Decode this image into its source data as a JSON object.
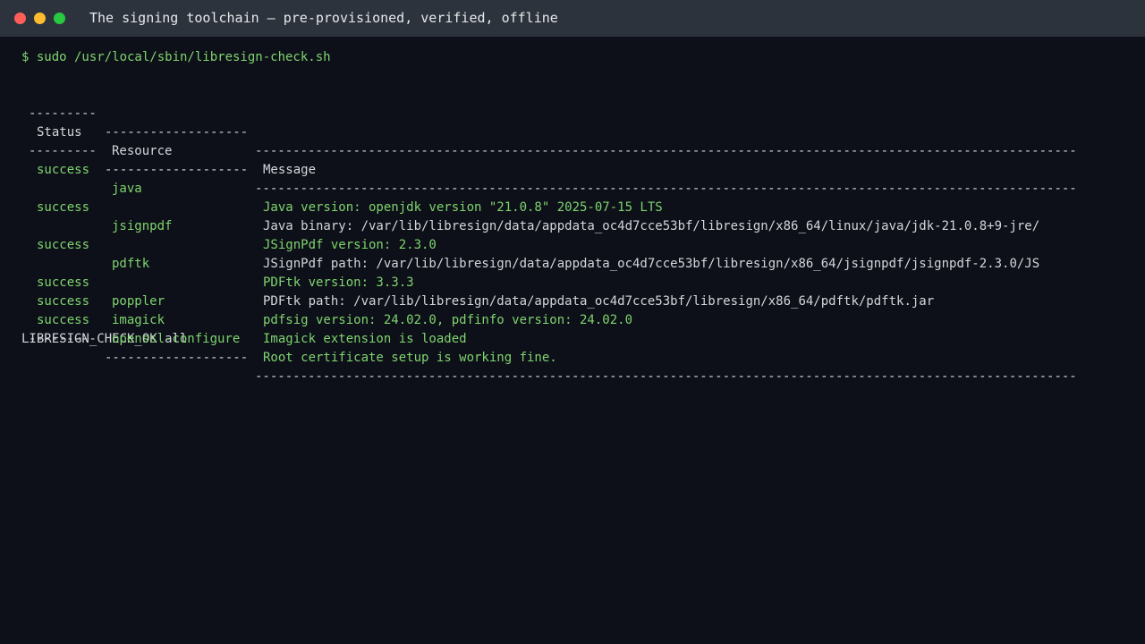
{
  "window": {
    "title": "The signing toolchain — pre-provisioned, verified, offline"
  },
  "terminal": {
    "command": "$ sudo /usr/local/sbin/libresign-check.sh",
    "separator": {
      "status": "---------",
      "resource": "-------------------",
      "message": "-------------------------------------------------------------------------------------------------------------"
    },
    "headers": {
      "status": "Status",
      "resource": "Resource",
      "message": "Message"
    },
    "rows": [
      {
        "status": "success",
        "resource": "java",
        "message": "Java version: openjdk version \"21.0.8\" 2025-07-15 LTS",
        "msg_color": "green"
      },
      {
        "status": "",
        "resource": "",
        "message": "Java binary: /var/lib/libresign/data/appdata_oc4d7cce53bf/libresign/x86_64/linux/java/jdk-21.0.8+9-jre/",
        "msg_color": "white"
      },
      {
        "status": "success",
        "resource": "jsignpdf",
        "message": "JSignPdf version: 2.3.0",
        "msg_color": "green"
      },
      {
        "status": "",
        "resource": "",
        "message": "JSignPdf path: /var/lib/libresign/data/appdata_oc4d7cce53bf/libresign/x86_64/jsignpdf/jsignpdf-2.3.0/JS",
        "msg_color": "white"
      },
      {
        "status": "success",
        "resource": "pdftk",
        "message": "PDFtk version: 3.3.3",
        "msg_color": "green"
      },
      {
        "status": "",
        "resource": "",
        "message": "PDFtk path: /var/lib/libresign/data/appdata_oc4d7cce53bf/libresign/x86_64/pdftk/pdftk.jar",
        "msg_color": "white"
      },
      {
        "status": "success",
        "resource": "poppler",
        "message": "pdfsig version: 24.02.0, pdfinfo version: 24.02.0",
        "msg_color": "green"
      },
      {
        "status": "success",
        "resource": "imagick",
        "message": "Imagick extension is loaded",
        "msg_color": "green"
      },
      {
        "status": "success",
        "resource": "openssl-configure",
        "message": "Root certificate setup is working fine.",
        "msg_color": "green"
      }
    ],
    "result": "LIBRESIGN_CHECK_OK all"
  },
  "colors": {
    "background": "#0d1018",
    "titlebar": "#2d333c",
    "success_green": "#7fd46f",
    "text": "#d4d6da"
  }
}
